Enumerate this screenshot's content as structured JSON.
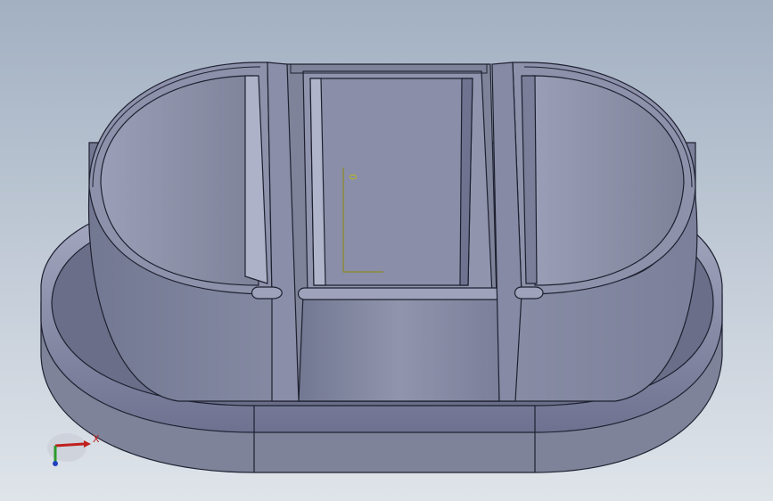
{
  "viewport": {
    "background_top": "#a2b0c2",
    "background_bottom": "#dfe4ea",
    "model_color": "#8a8fa8"
  },
  "sketch": {
    "label": "0"
  },
  "triad": {
    "x_label": "X",
    "x_color": "#c0201c",
    "y_color": "#2a9a2a",
    "z_color": "#2040c0"
  }
}
